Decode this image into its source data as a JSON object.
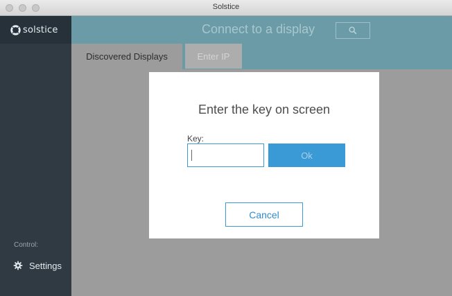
{
  "window": {
    "title": "Solstice"
  },
  "sidebar": {
    "logo_text": "solstice",
    "section_label": "Control:",
    "settings_label": "Settings"
  },
  "header": {
    "title": "Connect to a display"
  },
  "tabs": [
    {
      "label": "Discovered Displays",
      "active": true
    },
    {
      "label": "Enter IP",
      "active": false
    }
  ],
  "modal": {
    "title": "Enter the key on screen",
    "key_label": "Key:",
    "key_value": "",
    "ok_label": "Ok",
    "cancel_label": "Cancel"
  },
  "colors": {
    "accent": "#3a9ad6",
    "header": "#6c9ba8",
    "sidebar": "#2f3a43",
    "overlay": "#9c9c9c"
  },
  "icons": [
    "solstice-logo-icon",
    "search-icon",
    "gear-icon"
  ]
}
